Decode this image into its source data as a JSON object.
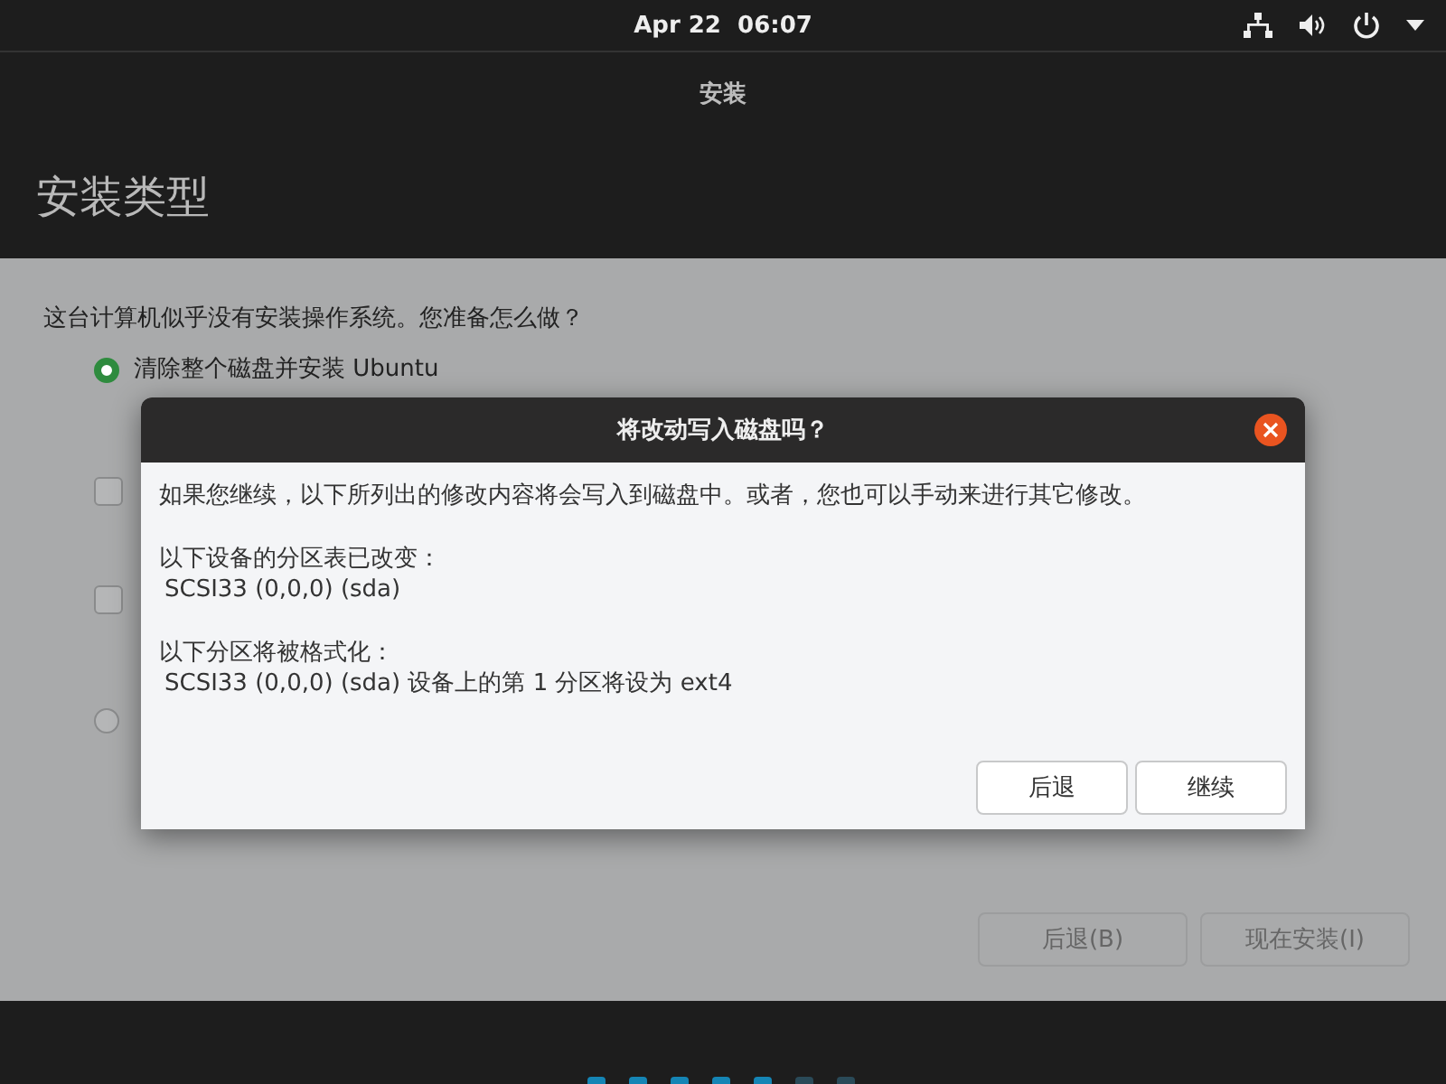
{
  "top_bar": {
    "clock": "Apr 22  06:07"
  },
  "window": {
    "title": "安装"
  },
  "page": {
    "heading": "安装类型",
    "question": "这台计算机似乎没有安装操作系统。您准备怎么做？",
    "options": [
      {
        "kind": "radio",
        "label": "清除整个磁盘并安装 Ubuntu",
        "selected": true
      },
      {
        "kind": "checkbox",
        "checked": false
      },
      {
        "kind": "checkbox",
        "checked": false
      },
      {
        "kind": "radio",
        "selected": false
      }
    ],
    "buttons": [
      {
        "label": "后退(B)",
        "disabled": true
      },
      {
        "label": "现在安装(I)",
        "disabled": true
      }
    ],
    "steps": [
      {
        "done": true
      },
      {
        "done": true
      },
      {
        "done": true
      },
      {
        "done": true
      },
      {
        "done": true
      },
      {
        "done": false
      },
      {
        "done": false
      }
    ]
  },
  "dialog": {
    "title": "将改动写入磁盘吗？",
    "intro": "如果您继续，以下所列出的修改内容将会写入到磁盘中。或者，您也可以手动来进行其它修改。",
    "sections": [
      {
        "heading": "以下设备的分区表已改变：",
        "items": [
          "SCSI33 (0,0,0) (sda)"
        ]
      },
      {
        "heading": "以下分区将被格式化：",
        "items": [
          "SCSI33 (0,0,0) (sda) 设备上的第 1 分区将设为 ext4"
        ]
      }
    ],
    "buttons": [
      {
        "label": "后退"
      },
      {
        "label": "继续"
      }
    ]
  }
}
